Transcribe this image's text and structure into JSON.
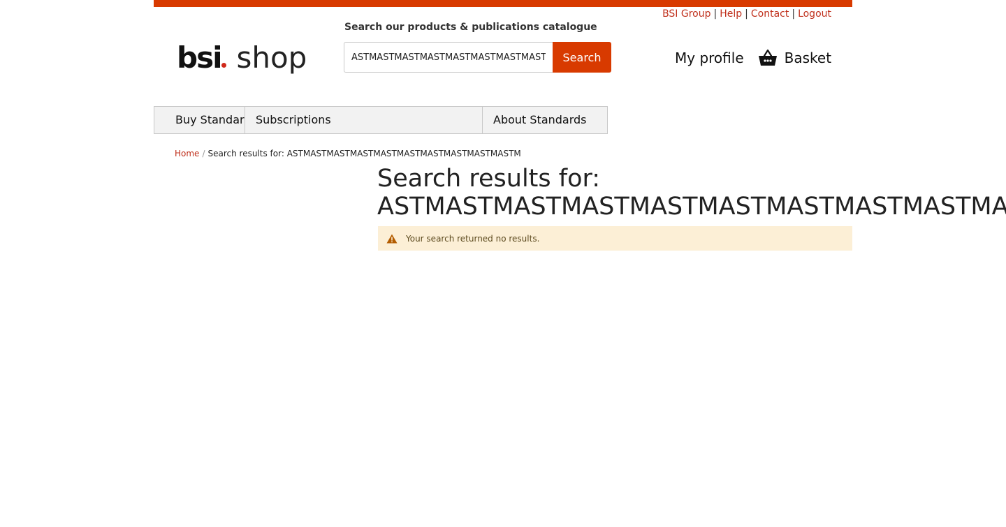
{
  "utility_links": [
    "BSI Group",
    "Help",
    "Contact",
    "Logout"
  ],
  "logo": {
    "brand": "bsi",
    "product": "shop"
  },
  "search": {
    "label": "Search our products & publications catalogue",
    "value": "ASTMASTMASTMASTMASTMASTMASTMASTMASTMASTM",
    "button_label": "Search"
  },
  "header": {
    "my_profile": "My profile",
    "basket": "Basket"
  },
  "nav": {
    "buy_standards": "Buy Standards",
    "subscriptions": "Subscriptions",
    "about_standards": "About Standards"
  },
  "breadcrumb": {
    "home": "Home",
    "current": "Search results for: ASTMASTMASTMASTMASTMASTMASTMASTMASTMASTM"
  },
  "results": {
    "title_prefix": "Search results for:",
    "query": "ASTMASTMASTMASTMASTMASTMASTMASTMASTMASTM"
  },
  "alert": {
    "message": "Your search returned no results."
  },
  "colors": {
    "brand_accent": "#d83a00",
    "link": "#c0301c",
    "alert_background": "#fcefd6",
    "warning_icon": "#b35c00"
  }
}
